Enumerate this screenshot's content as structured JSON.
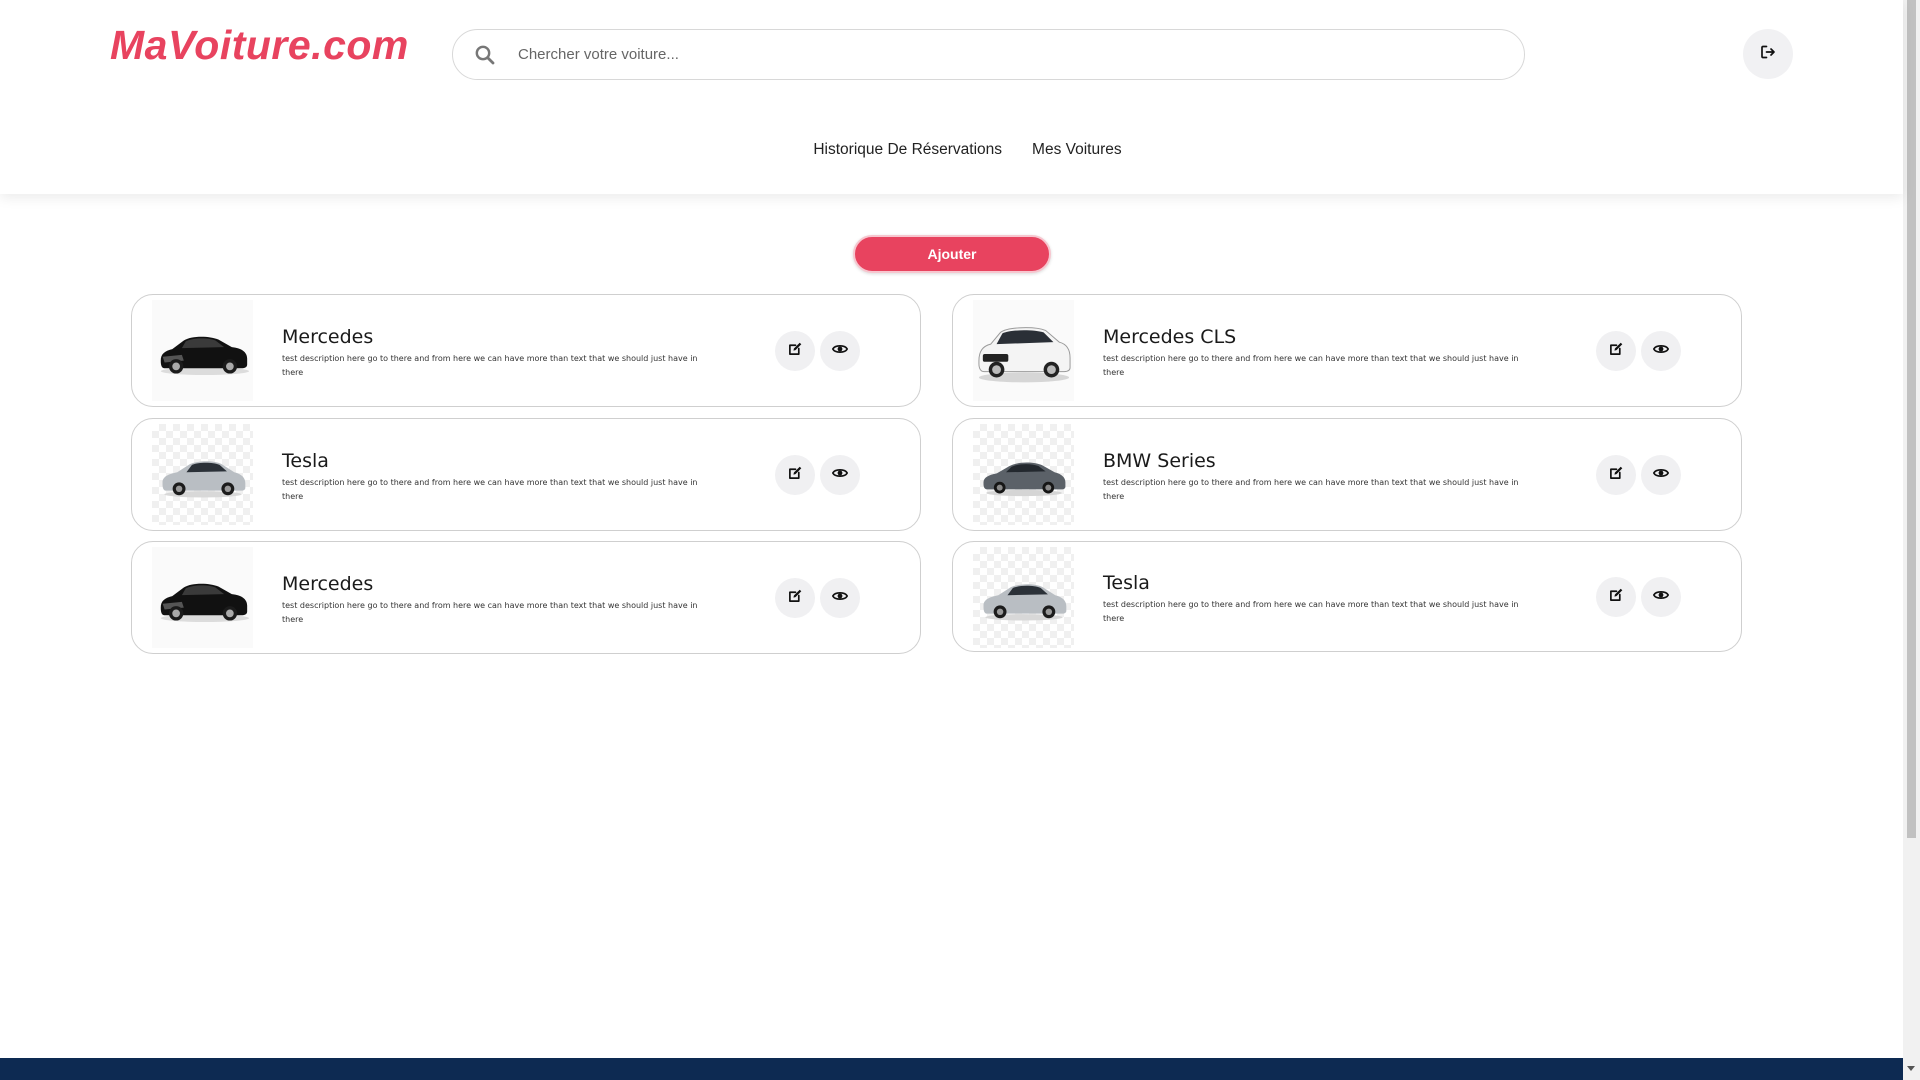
{
  "header": {
    "logo": "MaVoiture.com",
    "search_placeholder": "Chercher votre voiture...",
    "logout_icon": "logout-icon"
  },
  "nav": {
    "items": [
      "Historique De Réservations",
      "Mes Voitures"
    ]
  },
  "main": {
    "add_label": "Ajouter",
    "cars": [
      {
        "title": "Mercedes",
        "description": "test description here go to there and from here we can have more than text that we should just have in there",
        "image": "black-sedan"
      },
      {
        "title": "Mercedes CLS",
        "description": "test description here go to there and from here we can have more than text that we should just have in there",
        "image": "white-suv"
      },
      {
        "title": "Tesla",
        "description": "test description here go to there and from here we can have more than text that we should just have in there",
        "image": "silver-crossover"
      },
      {
        "title": "BMW Series",
        "description": "test description here go to there and from here we can have more than text that we should just have in there",
        "image": "gray-sedan"
      },
      {
        "title": "Mercedes",
        "description": "test description here go to there and from here we can have more than text that we should just have in there",
        "image": "black-sedan"
      },
      {
        "title": "Tesla",
        "description": "test description here go to there and from here we can have more than text that we should just have in there",
        "image": "silver-crossover"
      }
    ]
  },
  "colors": {
    "brand": "#e8435f",
    "footer": "#0d2a52"
  }
}
